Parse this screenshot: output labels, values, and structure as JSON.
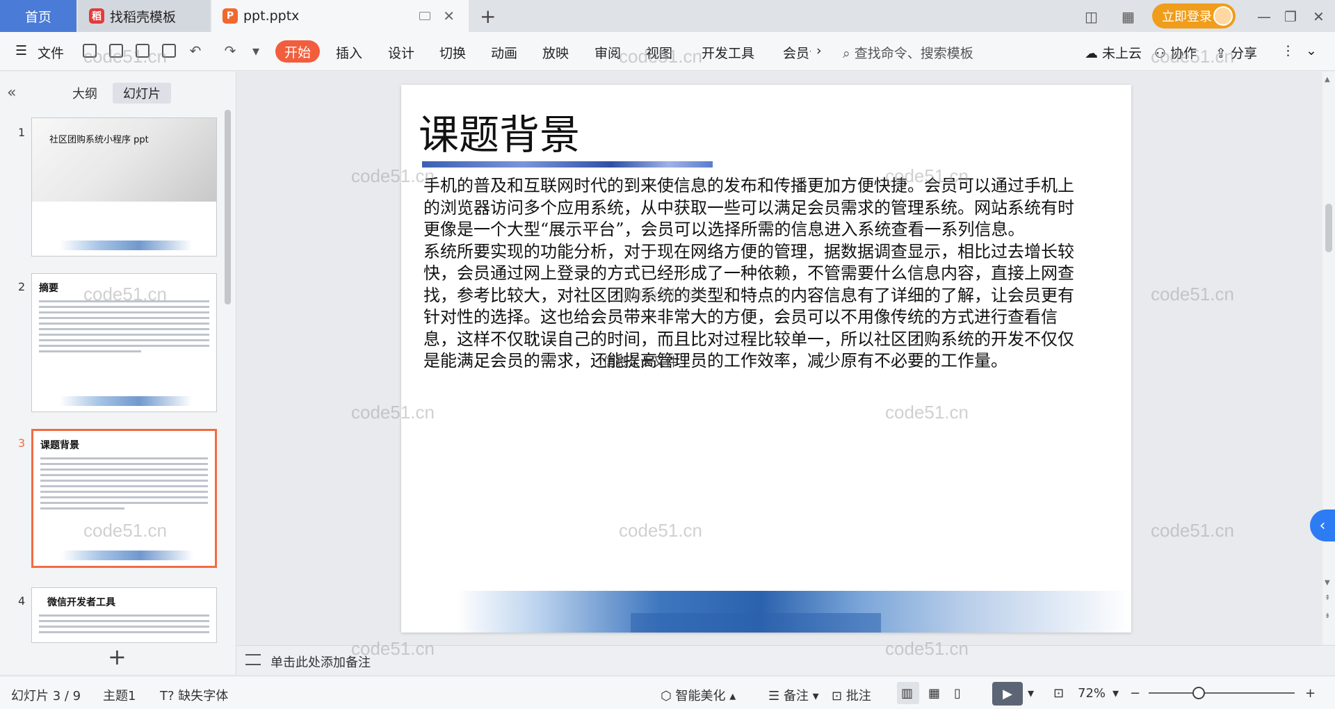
{
  "titlebar": {
    "home_tab": "首页",
    "template_tab": "找稻壳模板",
    "doc_tab": "ppt.pptx",
    "login": "立即登录"
  },
  "ribbon": {
    "file": "文件",
    "tabs": [
      "开始",
      "插入",
      "设计",
      "切换",
      "动画",
      "放映",
      "审阅",
      "视图",
      "开发工具",
      "会员专"
    ],
    "search_placeholder": "查找命令、搜索模板",
    "cloud": "未上云",
    "collab": "协作",
    "share": "分享"
  },
  "left_panel": {
    "outline_tab": "大纲",
    "slides_tab": "幻灯片",
    "thumbnails": [
      {
        "num": "1",
        "title": "社区团购系统小程序 ppt"
      },
      {
        "num": "2",
        "title": "摘要"
      },
      {
        "num": "3",
        "title": "课题背景"
      },
      {
        "num": "4",
        "title": "微信开发者工具"
      }
    ],
    "add": "+"
  },
  "slide": {
    "title": "课题背景",
    "paragraphs": [
      "手机的普及和互联网时代的到来使信息的发布和传播更加方便快捷。会员可以通过手机上的浏览器访问多个应用系统，从中获取一些可以满足会员需求的管理系统。网站系统有时更像是一个大型“展示平台”，会员可以选择所需的信息进入系统查看一系列信息。",
      "系统所要实现的功能分析，对于现在网络方便的管理，据数据调查显示，相比过去增长较快，会员通过网上登录的方式已经形成了一种依赖，不管需要什么信息内容，直接上网查找，参考比较大，对社区团购系统的类型和特点的内容信息有了详细的了解，让会员更有针对性的选择。这也给会员带来非常大的方便，会员可以不用像传统的方式进行查看信息，这样不仅耽误自己的时间，而且比对过程比较单一，所以社区团购系统的开发不仅仅是能满足会员的需求，还能提高管理员的工作效率，减少原有不必要的工作量。"
    ],
    "overlap_text": "信息久大又件"
  },
  "notes": {
    "placeholder": "单击此处添加备注"
  },
  "statusbar": {
    "slide_pos": "幻灯片 3 / 9",
    "theme": "主题1",
    "missing_font": "缺失字体",
    "beautify": "智能美化",
    "notes": "备注",
    "comment": "批注",
    "zoom": "72%"
  },
  "watermark": "code51.cn",
  "colors": {
    "accent": "#f25e3d",
    "home_tab": "#4a7bd6",
    "login": "#f09d1b",
    "side_tab": "#2d7cf4"
  }
}
